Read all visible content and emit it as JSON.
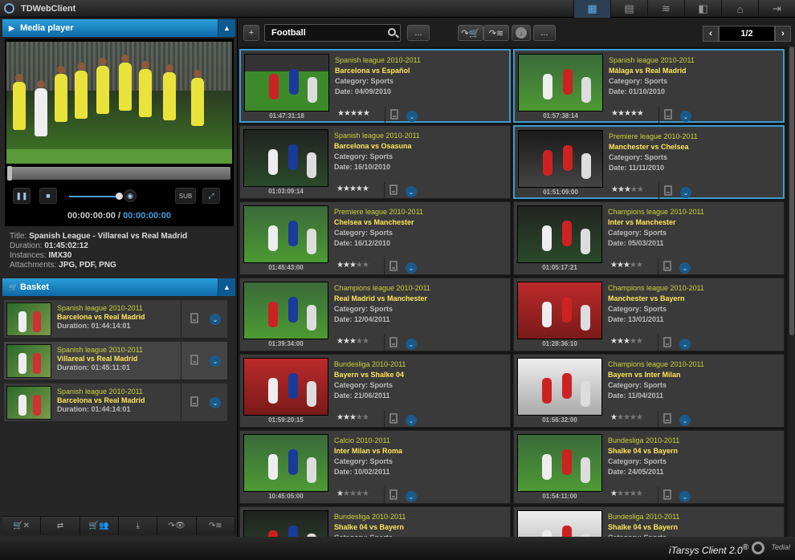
{
  "app": {
    "title": "TDWebClient",
    "brand": "iTarsys Client 2.0",
    "brand_mark": "®",
    "vendor": "Tedial"
  },
  "colors": {
    "accent": "#2a9ed8",
    "league": "#c9d33a",
    "match": "#ffe65a",
    "selected_border": "#3a9bcf"
  },
  "media_player": {
    "title": "Media player",
    "sub_label": "SUB",
    "time_current": "00:00:00:00",
    "time_separator": "/",
    "time_total": "00:00:00:00",
    "meta": [
      {
        "label": "Title:",
        "value": "Spanish League - Villareal vs Real Madrid"
      },
      {
        "label": "Duration:",
        "value": "01:45:02:12"
      },
      {
        "label": "Instances:",
        "value": "IMX30"
      },
      {
        "label": "Attachments:",
        "value": "JPG, PDF, PNG"
      }
    ]
  },
  "basket": {
    "title": "Basket",
    "items": [
      {
        "league": "Spanish league 2010-2011",
        "match": "Barcelona vs Real Madrid",
        "duration": "Duration: 01:44:14:01"
      },
      {
        "league": "Spanish league 2010-2011",
        "match": "Villareal vs Real Madrid",
        "duration": "Duration: 01:45:11:01"
      },
      {
        "league": "Spanish league 2010-2011",
        "match": "Barcelona vs Real Madrid",
        "duration": "Duration: 01:44:14:01"
      }
    ]
  },
  "toolbar": {
    "add_label": "+",
    "search_value": "Football",
    "more_label": "...",
    "more2_label": "...",
    "page": "1/2"
  },
  "results": [
    {
      "league": "Spanish league 2010-2011",
      "match": "Barcelona vs Español",
      "category": "Category: Sports",
      "date": "Date: 04/09/2010",
      "duration": "01:47:31:18",
      "rating": 5,
      "selected": true
    },
    {
      "league": "Spanish league 2010-2011",
      "match": "Málaga vs Real Madrid",
      "category": "Category: Sports",
      "date": "Date: 01/10/2010",
      "duration": "01:57:38:14",
      "rating": 5,
      "selected": true
    },
    {
      "league": "Spanish league 2010-2011",
      "match": "Barcelona vs Osasuna",
      "category": "Category: Sports",
      "date": "Date: 16/10/2010",
      "duration": "01:03:09:14",
      "rating": 5,
      "selected": false
    },
    {
      "league": "Premiere league 2010-2011",
      "match": "Manchester vs Chelsea",
      "category": "Category: Sports",
      "date": "Date: 11/11/2010",
      "duration": "01:51:09:00",
      "rating": 3,
      "selected": true
    },
    {
      "league": "Premiere league 2010-2011",
      "match": "Chelsea vs Manchester",
      "category": "Category: Sports",
      "date": "Date: 16/12/2010",
      "duration": "01:45:43:00",
      "rating": 3,
      "selected": false
    },
    {
      "league": "Champions league 2010-2011",
      "match": "Inter vs Manchester",
      "category": "Category: Sports",
      "date": "Date: 05/03/2011",
      "duration": "01:05:17:21",
      "rating": 3,
      "selected": false
    },
    {
      "league": "Champions league 2010-2011",
      "match": "Real Madrid vs Manchester",
      "category": "Category: Sports",
      "date": "Date: 12/04/2011",
      "duration": "01:39:34:00",
      "rating": 3,
      "selected": false
    },
    {
      "league": "Champions league 2010-2011",
      "match": "Manchester vs Bayern",
      "category": "Category: Sports",
      "date": "Date: 13/01/2011",
      "duration": "01:28:36:10",
      "rating": 3,
      "selected": false
    },
    {
      "league": "Bundesliga 2010-2011",
      "match": "Bayern vs Shalke 04",
      "category": "Category: Sports",
      "date": "Date: 21/06/2011",
      "duration": "01:59:20:15",
      "rating": 3,
      "selected": false
    },
    {
      "league": "Champions league 2010-2011",
      "match": "Bayern vs Inter Milan",
      "category": "Category: Sports",
      "date": "Date: 11/04/2011",
      "duration": "01:56:32:00",
      "rating": 1,
      "selected": false
    },
    {
      "league": "Calcio 2010-2011",
      "match": "Inter Milan vs Roma",
      "category": "Category: Sports",
      "date": "Date: 10/02/2011",
      "duration": "10:45:05:00",
      "rating": 1,
      "selected": false
    },
    {
      "league": "Bundesliga 2010-2011",
      "match": "Shalke 04 vs Bayern",
      "category": "Category: Sports",
      "date": "Date: 24/05/2011",
      "duration": "01:54:11:00",
      "rating": 1,
      "selected": false
    },
    {
      "league": "Bundesliga 2010-2011",
      "match": "Shalke 04 vs Bayern",
      "category": "Category: Sports",
      "date": "",
      "duration": "",
      "rating": 0,
      "selected": false
    },
    {
      "league": "Bundesliga 2010-2011",
      "match": "Shalke 04 vs Bayern",
      "category": "Category: Sports",
      "date": "",
      "duration": "",
      "rating": 0,
      "selected": false
    }
  ]
}
